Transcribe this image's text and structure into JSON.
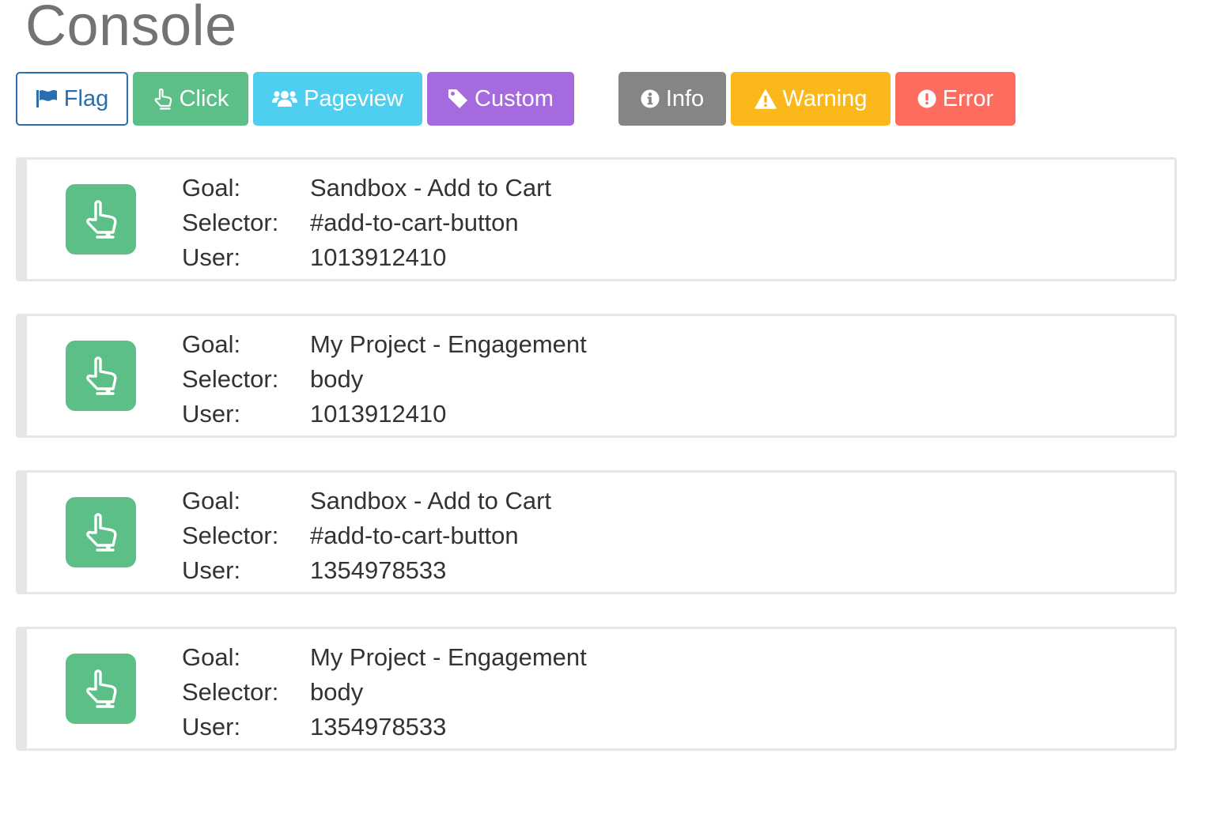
{
  "page": {
    "title": "Console"
  },
  "filters": {
    "flag": {
      "label": "Flag",
      "icon": "flag-icon",
      "color": "#2a6db0"
    },
    "click": {
      "label": "Click",
      "icon": "pointer-hand-icon",
      "color": "#5cbf87"
    },
    "pageview": {
      "label": "Pageview",
      "icon": "users-icon",
      "color": "#4fcff0"
    },
    "custom": {
      "label": "Custom",
      "icon": "tag-icon",
      "color": "#a56bde"
    },
    "info": {
      "label": "Info",
      "icon": "info-circle-icon",
      "color": "#858585"
    },
    "warning": {
      "label": "Warning",
      "icon": "warning-triangle-icon",
      "color": "#fbb81b"
    },
    "error": {
      "label": "Error",
      "icon": "exclamation-circle-icon",
      "color": "#fe6b5f"
    }
  },
  "logs": {
    "field_labels": {
      "goal": "Goal:",
      "selector": "Selector:",
      "user": "User:"
    },
    "items": [
      {
        "type": "click",
        "icon": "pointer-hand-icon",
        "goal": "Sandbox - Add to Cart",
        "selector": "#add-to-cart-button",
        "user": "1013912410"
      },
      {
        "type": "click",
        "icon": "pointer-hand-icon",
        "goal": "My Project - Engagement",
        "selector": "body",
        "user": "1013912410"
      },
      {
        "type": "click",
        "icon": "pointer-hand-icon",
        "goal": "Sandbox - Add to Cart",
        "selector": "#add-to-cart-button",
        "user": "1354978533"
      },
      {
        "type": "click",
        "icon": "pointer-hand-icon",
        "goal": "My Project - Engagement",
        "selector": "body",
        "user": "1354978533"
      }
    ]
  }
}
